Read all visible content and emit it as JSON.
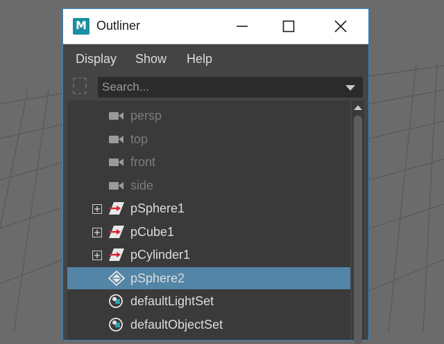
{
  "window": {
    "title": "Outliner",
    "app_icon_letter": "M"
  },
  "menu": {
    "items": [
      "Display",
      "Show",
      "Help"
    ]
  },
  "search": {
    "placeholder": "Search..."
  },
  "outliner": {
    "items": [
      {
        "label": "persp",
        "icon": "camera-icon",
        "dim": true,
        "expandable": false,
        "selected": false
      },
      {
        "label": "top",
        "icon": "camera-icon",
        "dim": true,
        "expandable": false,
        "selected": false
      },
      {
        "label": "front",
        "icon": "camera-icon",
        "dim": true,
        "expandable": false,
        "selected": false
      },
      {
        "label": "side",
        "icon": "camera-icon",
        "dim": true,
        "expandable": false,
        "selected": false
      },
      {
        "label": "pSphere1",
        "icon": "transform-icon",
        "dim": false,
        "expandable": true,
        "selected": false
      },
      {
        "label": "pCube1",
        "icon": "transform-icon",
        "dim": false,
        "expandable": true,
        "selected": false
      },
      {
        "label": "pCylinder1",
        "icon": "transform-icon",
        "dim": false,
        "expandable": true,
        "selected": false
      },
      {
        "label": "pSphere2",
        "icon": "group-icon",
        "dim": false,
        "expandable": false,
        "selected": true
      },
      {
        "label": "defaultLightSet",
        "icon": "set-icon",
        "dim": false,
        "expandable": false,
        "selected": false
      },
      {
        "label": "defaultObjectSet",
        "icon": "set-icon",
        "dim": false,
        "expandable": false,
        "selected": false
      }
    ]
  },
  "colors": {
    "selection": "#5285a6",
    "panel_bg": "#444444",
    "list_bg": "#3a3a3a",
    "accent_red": "#d9232e",
    "viewport_bg": "#6b6b6b"
  }
}
